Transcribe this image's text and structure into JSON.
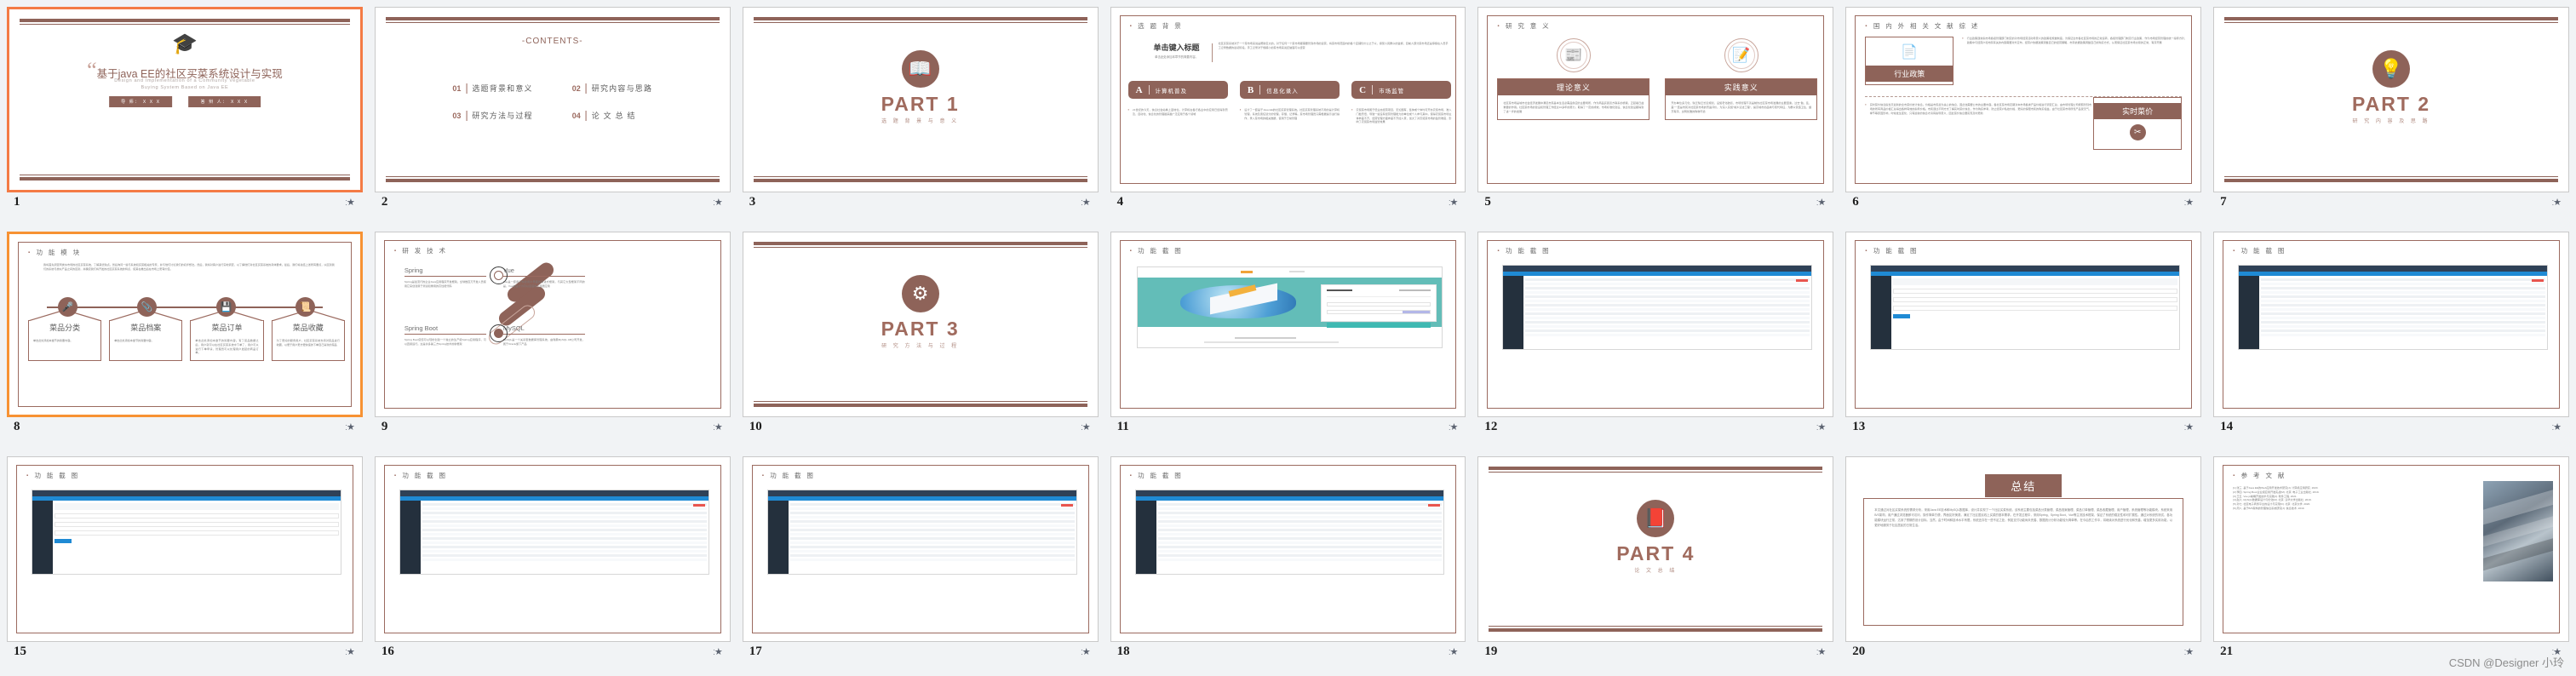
{
  "app": {
    "view": "slide-sorter",
    "accent": "#8e6359",
    "selection_color": "#f47b45",
    "watermark": "CSDN @Designer 小玲"
  },
  "slides": [
    {
      "number": "1",
      "type": "title",
      "selected": true,
      "title": "基于java EE的社区买菜系统设计与实现",
      "subtitle_line1": "Design and Implementation of a Community Vegetable",
      "subtitle_line2": "Buying  System  Based  on  Java  EE",
      "badges": [
        "导    师： X X X",
        "答 辩 人： X X X"
      ],
      "icon": "graduation-cap-icon"
    },
    {
      "number": "2",
      "type": "contents",
      "selected": false,
      "heading": "-CONTENTS-",
      "items": [
        {
          "num": "01",
          "label": "选题背景和意义"
        },
        {
          "num": "02",
          "label": "研究内容与思路"
        },
        {
          "num": "03",
          "label": "研究方法与过程"
        },
        {
          "num": "04",
          "label": "论  文  总  结"
        }
      ]
    },
    {
      "number": "3",
      "type": "part-divider",
      "selected": false,
      "part": "PART 1",
      "part_sub": "选 题 背 景 与 意 义",
      "icon": "open-book-icon"
    },
    {
      "number": "4",
      "type": "background",
      "selected": false,
      "heading": "选 题 背 景",
      "lead_title": "单击键入标题",
      "lead_sub": "单击此处添加本章节的简要内容。",
      "lead_body": "社区买菜系统对于一个菜市场来说是帮助巨大的。对于任何一个菜市场都需要管到市场的运营，将菜市场范围内的各个店铺售价公之于众，接受人民群众的监督，目前人部分菜市场还是停留在人员手工记录数据的最初阶段。手工记录对于规模小的菜市场来说还勉强可以经营",
      "cards": [
        {
          "letter": "A",
          "title": "计算机普及",
          "body": "21世纪的今天，信息社会站看上盗地位。计算机在各行各业中的应用已经得到普及，自动化、信息化的管理越来越广泛应用于各个领域"
        },
        {
          "letter": "B",
          "title": "信息化录入",
          "body": "设计了一套基于Java EE的社区买菜管理系统。社区买菜管理系统不用的是计算机管理，系统及责任划分的管理，存储、记录等。菜市场管理员只需根据提示进行操作，录入菜市场的相关数据，使用于日常管理"
        },
        {
          "letter": "C",
          "title": "市场监管",
          "body": "农贸菜市场属于低业态经营项目，无论国有、集体或个体均可开办农贸市场，准入门槛普低，导致一些没有经营管理能力的单位或个人参与其中。使得农贸菜市场主体参差不齐，经营管理方面参差不齐加人意，加大了对农贸菜市场的监管难度，影响了农贸菜市场监管效果"
        }
      ]
    },
    {
      "number": "5",
      "type": "significance",
      "selected": false,
      "heading": "研 究 意 义",
      "cards": [
        {
          "icon": "newspaper-icon",
          "title": "理论意义",
          "body": "社区菜市场是城市社会经济发展中满足市民基本生活必需品供应的主要场所，作为商品买卖双方联系的桥梁，正起着日益重要的作用。社区菜市场的建设和管理工作经过10多年的努力，取得了一定的成效，市场标准化建设、信息化建设都得到了进一步的发展"
        },
        {
          "icon": "pen-paper-icon",
          "title": "实践意义",
          "body": "开办单位多元化、缺乏缺乏长远规划、设施老化破损、市场管理不善是制约社区菜市场发展的主要因素。过去\"脏、乱、差\"一直是市民对社区菜市场的普遍评价。为深入实施\"城乡清洁工程\"，提高城市的品味与现代特征，为群众营造卫生、整齐有序、文明优雅的购物环境"
        }
      ]
    },
    {
      "number": "6",
      "type": "literature",
      "selected": false,
      "heading": "国 内 外 相 关 文 献 综 述",
      "callout1": {
        "label": "行业政策",
        "icon": "document-icon",
        "body": "行业政策通常指市场各级管理部门制定的对市场经营活动导意义的政策和规章制度。为保证全市各社区菜市场的正常运转，各级管理部门制定行业政策，作为市场经营管理的统一指导方针，政策中与经营户和市民有关的内容需要对外宣布，经营户依据政策调整自己的经营策略，市民依据政策调整自己的购买方式，从而保证社区菜市场交易的正常、有序开展"
      },
      "callout2": {
        "label": "实时菜价",
        "icon": "tools-icon",
        "body": "实时菜价信息指当天最新的全市菜价统计信息。价格是市民最为关心的信息，因此也需要公布的主要内容。各社区菜市场定期对本市场各类产品价格进行调查汇总，由市场管理公司按照管辖市场的所有商品价格汇总得出各样有效的指导价格。市民通过不同方式了解实时菜价信息，作为购买参考，防止经营户私抬价格，更好的保障市民的购买权益。由于社区菜市场所售产品受天气、季节等原因影响，时常发生变化，只有最新的信息才具有指导意义，因此菜价信息要实现及时更新"
      }
    },
    {
      "number": "7",
      "type": "part-divider",
      "selected": false,
      "part": "PART 2",
      "part_sub": "研 究 内 容 及 思 路",
      "icon": "lightbulb-idea-icon"
    },
    {
      "number": "8",
      "type": "modules",
      "selected": true,
      "heading": "功 能 模 块",
      "lead": "我将首先调查同类似市场的社区买菜系统，了解其优缺点。然后询问一些与系统和买菜相关的专家，并与他们讨论我们的初步想法。然后，我将对客户进行实地调查，以了解他们对社区买菜系统的具体要求。最后，我们将总结上述所有要点，以区别我们的系统与类似产品之间的区别，并确定我们将开发的社区买菜系统的特点，使其在推出后在市场上更有价值。",
      "items": [
        {
          "icon": "microphone-icon",
          "title": "菜品分类",
          "body": "单击此处添加本章节的简要内容。"
        },
        {
          "icon": "paperclip-icon",
          "title": "菜品档案",
          "body": "单击此处添加本章节的简要内容。"
        },
        {
          "icon": "floppy-disk-icon",
          "title": "菜品订单",
          "body": "单击此处添加本章节的简要内容。有了菜品数据之后，用户就可以在社区买菜系统中下单了，用户可以进行下单申请，管理员可以处理用户发起的商品订单。"
        },
        {
          "icon": "hand-document-icon",
          "title": "菜品收藏",
          "body": "为了更好的服务用户，社区买菜系统支持对菜品进行收藏，以便于用户更方便快速的下单自己喜欢的菜品"
        }
      ]
    },
    {
      "number": "9",
      "type": "tech",
      "selected": false,
      "heading": "研 发 技 术",
      "techs": [
        {
          "name": "Spring",
          "body": "Spring是最流行的企业Java应用程序开发框架。全球数百万开发人员使用它来创建易于测试和重用的高性能代码"
        },
        {
          "name": "Vue",
          "body": "Vue是一套用于构建用户界面的渐进式框架。与其它大型框架不同的是，Vue被设计为可以自底向上逐层应用"
        },
        {
          "name": "Spring Boot",
          "body": "Spring Boot使您可以轻松创建一个独立的生产级Spring应用程序，可以直接运行。这是许多第三方Spring技术的新框架"
        },
        {
          "name": "MySQL",
          "body": "MySQL是一个关系型数据库管理系统，由瑞典MySQL AB公司开发，属于Oracle旗下产品"
        }
      ]
    },
    {
      "number": "10",
      "type": "part-divider",
      "selected": false,
      "part": "PART 3",
      "part_sub": "研 究 方 法 与 过 程",
      "icon": "gears-icon"
    },
    {
      "number": "11",
      "type": "screenshot",
      "selected": false,
      "heading": "功 能 截 图",
      "shot": "login-page"
    },
    {
      "number": "12",
      "type": "screenshot",
      "selected": false,
      "heading": "功 能 截 图",
      "shot": "admin-table"
    },
    {
      "number": "13",
      "type": "screenshot",
      "selected": false,
      "heading": "功 能 截 图",
      "shot": "admin-form"
    },
    {
      "number": "14",
      "type": "screenshot",
      "selected": false,
      "heading": "功 能 截 图",
      "shot": "admin-table"
    },
    {
      "number": "15",
      "type": "screenshot",
      "selected": false,
      "heading": "功 能 截 图",
      "shot": "admin-form"
    },
    {
      "number": "16",
      "type": "screenshot",
      "selected": false,
      "heading": "功 能 截 图",
      "shot": "admin-table"
    },
    {
      "number": "17",
      "type": "screenshot",
      "selected": false,
      "heading": "功 能 截 图",
      "shot": "admin-table"
    },
    {
      "number": "18",
      "type": "screenshot",
      "selected": false,
      "heading": "功 能 截 图",
      "shot": "admin-table"
    },
    {
      "number": "19",
      "type": "part-divider",
      "selected": false,
      "part": "PART 4",
      "part_sub": "论 文 总 结",
      "icon": "book-icon"
    },
    {
      "number": "20",
      "type": "summary",
      "selected": false,
      "banner": "总结",
      "body": "本文通过对社区买菜系统的需求分析，采用Java EE技术和MySQL数据库，设计并实现了一个社区买菜系统。该系统主要包括菜品分类管理、菜品档案管理、菜品订单管理、菜品收藏管理、用户管理、系统管理等功能模块。系统采用B/S架构，用户通过浏览器即可访问，操作简单方便，界面友好美观，满足了社区居民线上买菜的基本需求。在开发过程中，采用Spring、Spring Boot、Vue等主流技术框架，保证了系统的稳定性和可扩展性。通过对系统的测试，各功能模块运行正常，达到了预期的设计目标。当然，由于时间和技术水平有限，系统还存在一些不足之处，例如支付功能尚未完善、数据统计分析功能较为简单等。在今后的工作中，将继续对系统进行优化和完善，增加更多实用功能，以更好地服务于社区居民的日常生活。"
    },
    {
      "number": "21",
      "type": "references",
      "selected": false,
      "heading": "参 考 文 献",
      "body": "[1] 张三. 基于Java EE的Web应用开发技术研究[J]. 计算机应用研究, 2020.\n[2] 李四. Spring Boot企业级应用开发实战[M]. 北京: 电子工业出版社, 2019.\n[3] 王五. Vue.js前端开发技术与实践[J]. 软件工程, 2021.\n[4] 赵六. MySQL数据库设计与优化[M]. 北京: 清华大学出版社, 2018.\n[5] 孙七. 社区电子商务平台的设计与实现[D]. 北京: 北京大学, 2020.\n[6] 周八. 基于B/S架构的管理信息系统研究[J]. 信息技术, 2019.",
      "image": "architecture-photo"
    }
  ]
}
